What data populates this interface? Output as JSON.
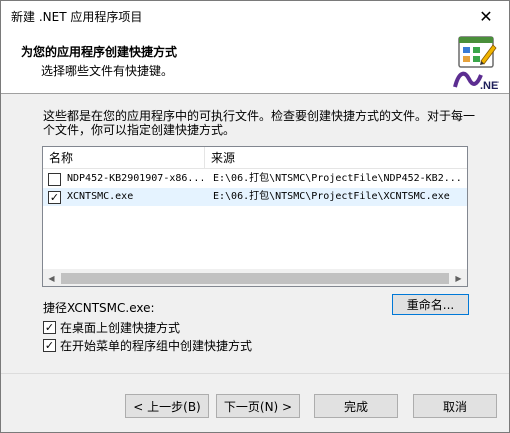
{
  "window": {
    "title": "新建 .NET 应用程序项目",
    "close_glyph": "✕"
  },
  "header": {
    "title": "为您的应用程序创建快捷方式",
    "subtitle": "选择哪些文件有快捷键。",
    "logo_text": ".NET",
    "logo_icon": "dotnet-shortcut-logo-icon"
  },
  "description": "这些都是在您的应用程序中的可执行文件。检查要创建快捷方式的文件。对于每一个文件，你可以指定创建快捷方式。",
  "file_list": {
    "columns": [
      "名称",
      "来源"
    ],
    "rows": [
      {
        "checked": false,
        "name": "NDP452-KB2901907-x86...",
        "source": "E:\\06.打包\\NTSMC\\ProjectFile\\NDP452-KB2..."
      },
      {
        "checked": true,
        "name": "XCNTSMC.exe",
        "source": "E:\\06.打包\\NTSMC\\ProjectFile\\XCNTSMC.exe"
      }
    ]
  },
  "shortcut": {
    "label": "捷径XCNTSMC.exe:",
    "rename_button": "重命名..."
  },
  "options": [
    {
      "label": "在桌面上创建快捷方式",
      "checked": true
    },
    {
      "label": "在开始菜单的程序组中创建快捷方式",
      "checked": true
    }
  ],
  "buttons": {
    "back": "< 上一步(B)",
    "next": "下一页(N) >",
    "finish": "完成",
    "cancel": "取消"
  },
  "colors": {
    "accent": "#0078d7",
    "selected_row": "#e5f3ff"
  }
}
